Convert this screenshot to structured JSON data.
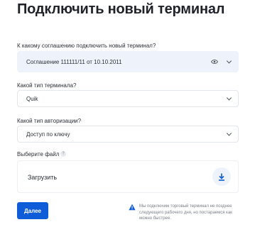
{
  "page": {
    "title": "Подключить новый терминал"
  },
  "agreement": {
    "label": "К какому соглашению подключить новый терминал?",
    "value": "Соглашение 111111/11 от 10.10.2011",
    "icons": [
      "eye-icon",
      "chevron-down-icon"
    ]
  },
  "terminal_type": {
    "label": "Какой тип терминала?",
    "value": "Quik",
    "icons": [
      "chevron-down-icon"
    ]
  },
  "auth_type": {
    "label": "Какой тип авторизации?",
    "value": "Доступ по ключу",
    "icons": [
      "chevron-down-icon"
    ]
  },
  "file": {
    "label": "Выберите файл",
    "help_glyph": "?",
    "upload_label": "Загрузить",
    "upload_icon": "download-icon"
  },
  "actions": {
    "next_label": "Далее"
  },
  "notice": {
    "icon": "warning-icon",
    "text": "Мы подключим торговый терминал не позднее следующего рабочего дня, но постараемся как можно быстрее."
  },
  "colors": {
    "accent": "#0f5cd8",
    "field_shaded": "#eef3fb",
    "border": "#e3e6ea",
    "muted_text": "#7a7f87"
  }
}
